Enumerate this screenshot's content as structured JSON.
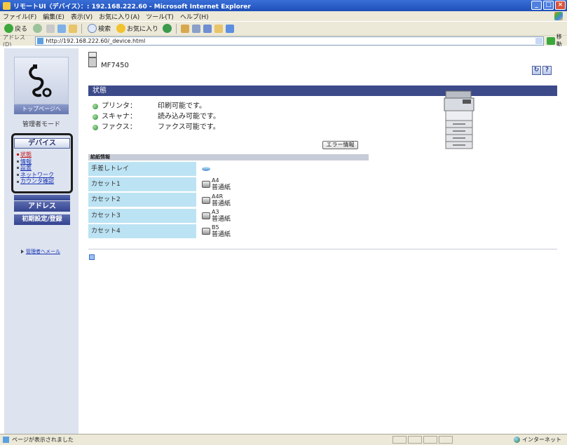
{
  "window": {
    "title": "リモートUI〈デバイス〉：: 192.168.222.60 - Microsoft Internet Explorer"
  },
  "menubar": {
    "items": [
      "ファイル(F)",
      "編集(E)",
      "表示(V)",
      "お気に入り(A)",
      "ツール(T)",
      "ヘルプ(H)"
    ]
  },
  "toolbar": {
    "back_label": "戻る",
    "search_label": "検索",
    "favorites_label": "お気に入り"
  },
  "addressbar": {
    "label": "アドレス(D)",
    "url": "http://192.168.222.60/_device.html",
    "go_label": "移動"
  },
  "sidebar": {
    "top_page_button": "トップページへ",
    "mode_label": "管理者モード",
    "device_button": "デバイス",
    "sub_items": [
      {
        "label": "状態",
        "active": true
      },
      {
        "label": "情報",
        "active": false
      },
      {
        "label": "設置",
        "active": false
      },
      {
        "label": "ネットワーク",
        "active": false
      },
      {
        "label": "カウンタ確認",
        "active": false
      }
    ],
    "address_button": "アドレス",
    "settings_button": "初期設定/登録",
    "mail_link": "管理者へメール"
  },
  "main": {
    "model_name": "MF7450",
    "section_title": "状態",
    "status": [
      {
        "name": "プリンタ：",
        "value": "印刷可能です。"
      },
      {
        "name": "スキャナ：",
        "value": "読み込み可能です。"
      },
      {
        "name": "ファクス：",
        "value": "ファクス可能です。"
      }
    ],
    "error_button": "エラー情報",
    "feed_title": "給紙情報",
    "feeds": [
      {
        "tray": "手差しトレイ",
        "size": "",
        "paper": ""
      },
      {
        "tray": "カセット1",
        "size": "A4",
        "paper": "普通紙"
      },
      {
        "tray": "カセット2",
        "size": "A4R",
        "paper": "普通紙"
      },
      {
        "tray": "カセット3",
        "size": "A3",
        "paper": "普通紙"
      },
      {
        "tray": "カセット4",
        "size": "B5",
        "paper": "普通紙"
      }
    ]
  },
  "statusbar": {
    "text": "ページが表示されました",
    "zone": "インターネット"
  },
  "colors": {
    "section_bar": "#3c4a8a",
    "tray_cell": "#bce3f3",
    "nav_button": "#344390",
    "active_link": "#c4161c",
    "link": "#1b37b6"
  }
}
